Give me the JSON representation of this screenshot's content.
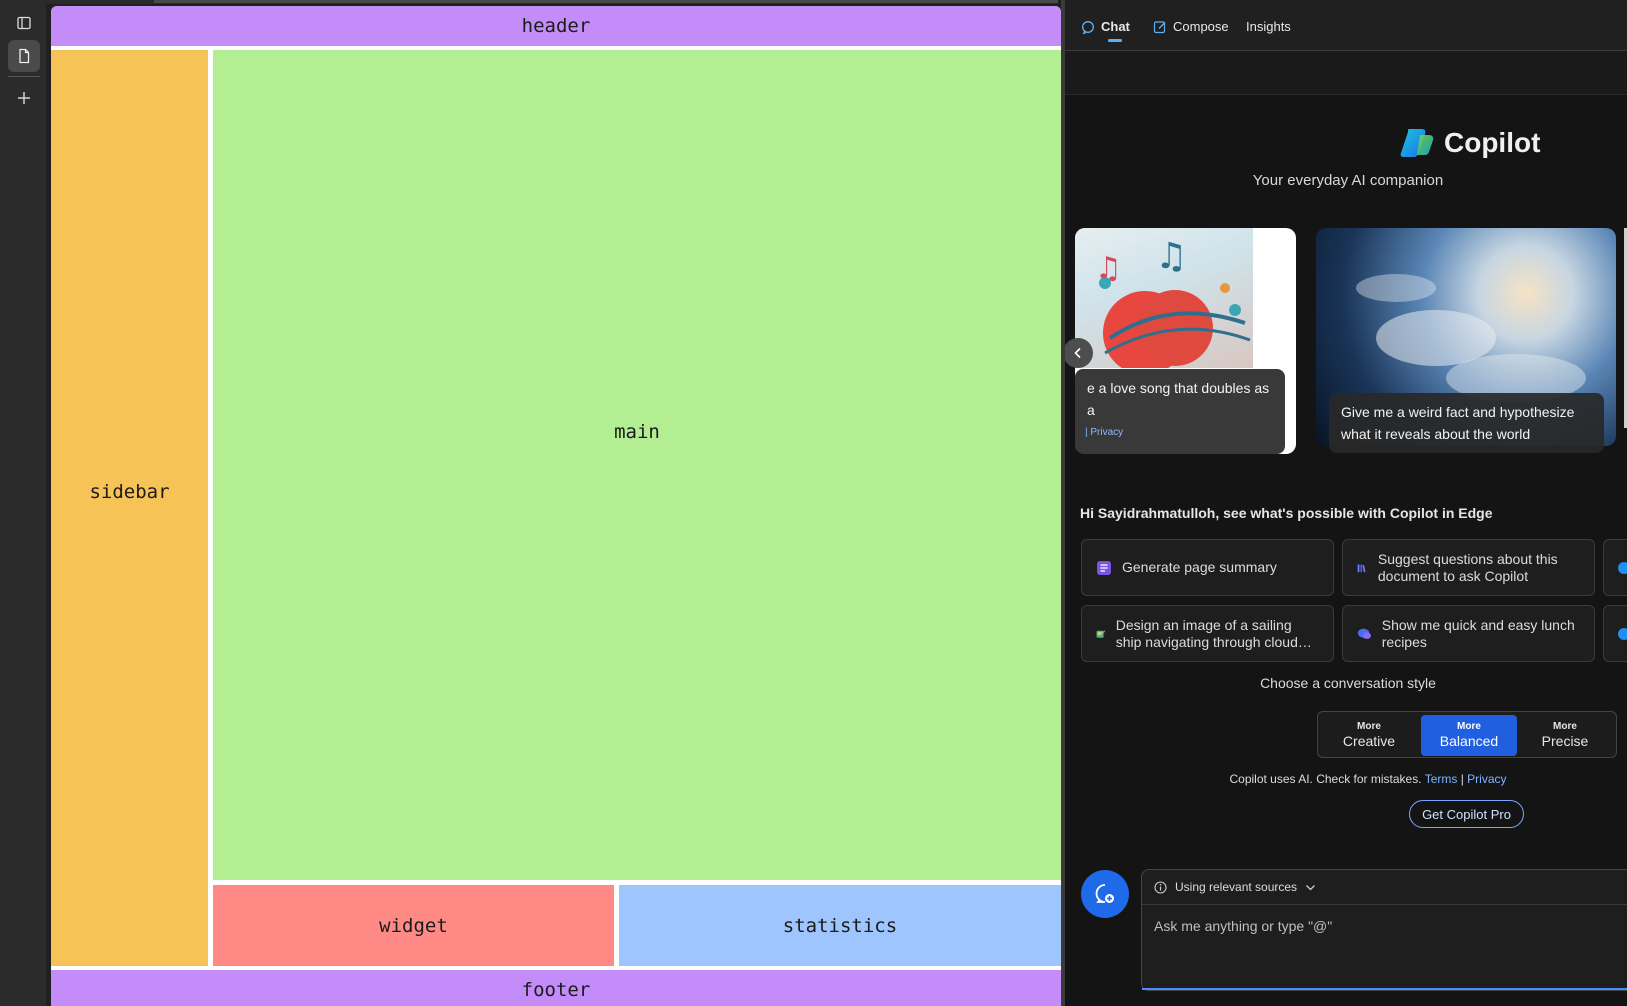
{
  "grid_demo": {
    "header": "header",
    "sidebar": "sidebar",
    "main": "main",
    "widget": "widget",
    "statistics": "statistics",
    "footer": "footer",
    "colors": {
      "header_footer": "#c48cf8",
      "sidebar": "#f5c356",
      "main": "#b4ee93",
      "widget": "#ff8a85",
      "statistics": "#9ec5fe"
    }
  },
  "rail": {
    "icons": [
      "sidebar-toggle-icon",
      "document-icon",
      "plus-icon"
    ]
  },
  "copilot": {
    "tabs": [
      {
        "label": "Chat",
        "icon": "chat-icon",
        "active": true
      },
      {
        "label": "Compose",
        "icon": "compose-icon"
      },
      {
        "label": "Insights"
      }
    ],
    "title": "Copilot",
    "tagline": "Your everyday AI companion",
    "cards": [
      {
        "caption": "e a love song that doubles as a",
        "footer_link": "Privacy"
      },
      {
        "caption": "Give me a weird fact and hypothesize what it reveals about the world"
      }
    ],
    "greeting": "Hi Sayidrahmatulloh, see what's possible with Copilot in Edge",
    "suggestions": [
      {
        "label": "Generate page summary",
        "icon": "summary-icon"
      },
      {
        "label": "Suggest questions about this document to ask Copilot",
        "icon": "books-icon"
      },
      {
        "label": "Design an image of a sailing ship navigating through cloud…",
        "icon": "image-design-icon"
      },
      {
        "label": "Show me quick and easy lunch recipes",
        "icon": "chat-bubbles-icon"
      }
    ],
    "style_prompt": "Choose a conversation style",
    "styles": [
      {
        "more": "More",
        "name": "Creative"
      },
      {
        "more": "More",
        "name": "Balanced",
        "active": true
      },
      {
        "more": "More",
        "name": "Precise"
      }
    ],
    "disclaimer": {
      "text": "Copilot uses AI. Check for mistakes.",
      "terms": "Terms",
      "divider": "|",
      "privacy": "Privacy"
    },
    "pro_button": "Get Copilot Pro",
    "composer": {
      "sources_label": "Using relevant sources",
      "placeholder": "Ask me anything or type \"@\""
    },
    "accent": "#1f5fe0"
  }
}
